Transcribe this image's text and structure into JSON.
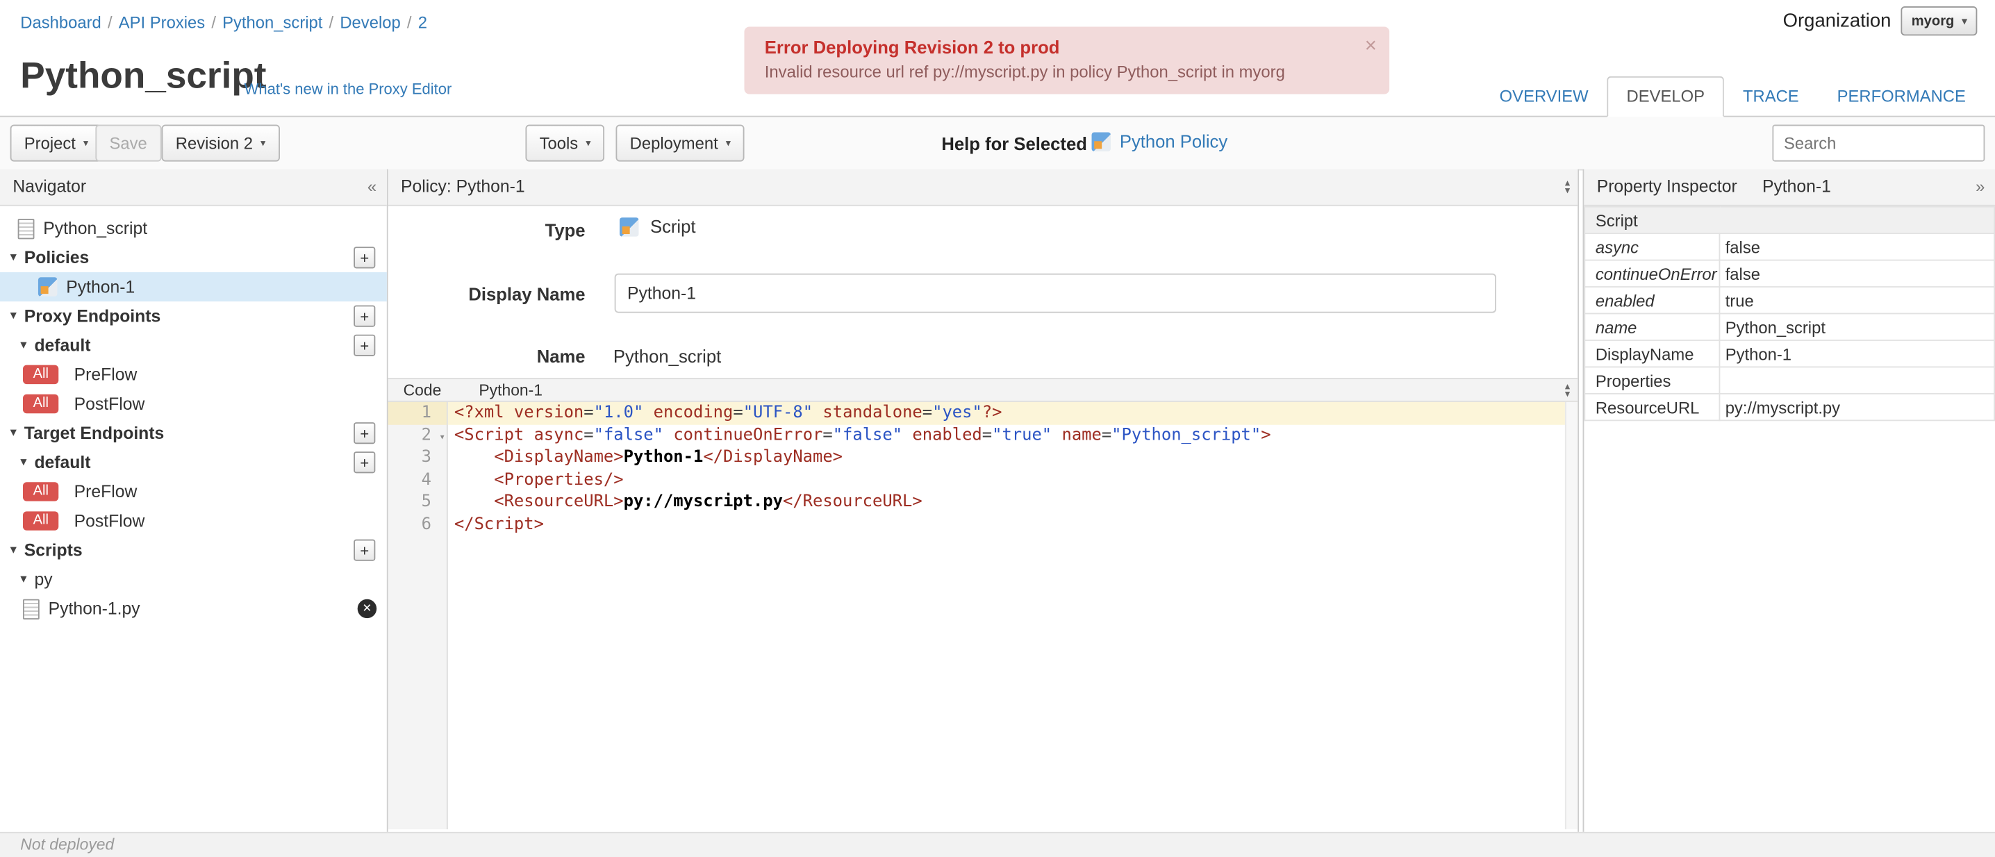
{
  "icons": {
    "caret_down": "▾",
    "caret_up": "▴",
    "collapse_left": "«",
    "expand_right": "»",
    "plus": "+",
    "close": "×",
    "delete": "✕"
  },
  "breadcrumb": {
    "separator": "/",
    "items": [
      "Dashboard",
      "API Proxies",
      "Python_script",
      "Develop",
      "2"
    ]
  },
  "organization": {
    "label": "Organization",
    "value": "myorg"
  },
  "alert": {
    "title": "Error Deploying Revision 2 to prod",
    "message": "Invalid resource url ref py://myscript.py in policy Python_script in myorg"
  },
  "page": {
    "title": "Python_script",
    "whats_new": "What's new in the Proxy Editor"
  },
  "tabs": {
    "overview": "OVERVIEW",
    "develop": "DEVELOP",
    "trace": "TRACE",
    "performance": "PERFORMANCE"
  },
  "toolbar": {
    "project": "Project",
    "save": "Save",
    "revision": "Revision 2",
    "tools": "Tools",
    "deployment": "Deployment",
    "help_for_selected": "Help for Selected",
    "policy_help": "Python Policy",
    "search_placeholder": "Search"
  },
  "navigator": {
    "title": "Navigator",
    "items": [
      {
        "label": "Python_script"
      },
      {
        "label": "Policies"
      },
      {
        "label": "Python-1"
      },
      {
        "label": "Proxy Endpoints"
      },
      {
        "label": "default"
      },
      {
        "badge": "All",
        "label": "PreFlow"
      },
      {
        "badge": "All",
        "label": "PostFlow"
      },
      {
        "label": "Target Endpoints"
      },
      {
        "label": "default"
      },
      {
        "badge": "All",
        "label": "PreFlow"
      },
      {
        "badge": "All",
        "label": "PostFlow"
      },
      {
        "label": "Scripts"
      },
      {
        "label": "py"
      },
      {
        "label": "Python-1.py"
      }
    ]
  },
  "policy_panel": {
    "title": "Policy: Python-1",
    "type_label": "Type",
    "type_value": "Script",
    "display_name_label": "Display Name",
    "display_name_value": "Python-1",
    "name_label": "Name",
    "name_value": "Python_script"
  },
  "code_panel": {
    "title": "Code",
    "subtitle": "Python-1",
    "lines": [
      {
        "no": 1,
        "active": true,
        "fold": false,
        "tokens": [
          [
            "tag",
            "<?xml"
          ],
          [
            "plain",
            " "
          ],
          [
            "attr",
            "version"
          ],
          [
            "op",
            "="
          ],
          [
            "str",
            "\"1.0\""
          ],
          [
            "plain",
            " "
          ],
          [
            "attr",
            "encoding"
          ],
          [
            "op",
            "="
          ],
          [
            "str",
            "\"UTF-8\""
          ],
          [
            "plain",
            " "
          ],
          [
            "attr",
            "standalone"
          ],
          [
            "op",
            "="
          ],
          [
            "str",
            "\"yes\""
          ],
          [
            "tag",
            "?>"
          ]
        ]
      },
      {
        "no": 2,
        "active": false,
        "fold": true,
        "tokens": [
          [
            "tag",
            "<Script"
          ],
          [
            "plain",
            " "
          ],
          [
            "attr",
            "async"
          ],
          [
            "op",
            "="
          ],
          [
            "str",
            "\"false\""
          ],
          [
            "plain",
            " "
          ],
          [
            "attr",
            "continueOnError"
          ],
          [
            "op",
            "="
          ],
          [
            "str",
            "\"false\""
          ],
          [
            "plain",
            " "
          ],
          [
            "attr",
            "enabled"
          ],
          [
            "op",
            "="
          ],
          [
            "str",
            "\"true\""
          ],
          [
            "plain",
            " "
          ],
          [
            "attr",
            "name"
          ],
          [
            "op",
            "="
          ],
          [
            "str",
            "\"Python_script\""
          ],
          [
            "tag",
            ">"
          ]
        ]
      },
      {
        "no": 3,
        "active": false,
        "fold": false,
        "tokens": [
          [
            "plain",
            "    "
          ],
          [
            "tag",
            "<DisplayName>"
          ],
          [
            "text",
            "Python-1"
          ],
          [
            "tag",
            "</DisplayName>"
          ]
        ]
      },
      {
        "no": 4,
        "active": false,
        "fold": false,
        "tokens": [
          [
            "plain",
            "    "
          ],
          [
            "tag",
            "<Properties/>"
          ]
        ]
      },
      {
        "no": 5,
        "active": false,
        "fold": false,
        "tokens": [
          [
            "plain",
            "    "
          ],
          [
            "tag",
            "<ResourceURL>"
          ],
          [
            "text",
            "py://myscript.py"
          ],
          [
            "tag",
            "</ResourceURL>"
          ]
        ]
      },
      {
        "no": 6,
        "active": false,
        "fold": false,
        "tokens": [
          [
            "tag",
            "</Script>"
          ]
        ]
      }
    ]
  },
  "property_inspector": {
    "title": "Property Inspector",
    "subtitle": "Python-1",
    "section": "Script",
    "rows": [
      {
        "label": "async",
        "value": "false"
      },
      {
        "label": "continueOnError",
        "value": "false"
      },
      {
        "label": "enabled",
        "value": "true"
      },
      {
        "label": "name",
        "value": "Python_script"
      },
      {
        "label": "DisplayName",
        "value": "Python-1"
      },
      {
        "label": "Properties",
        "value": ""
      },
      {
        "label": "ResourceURL",
        "value": "py://myscript.py"
      }
    ]
  },
  "status_bar": {
    "text": "Not deployed"
  }
}
